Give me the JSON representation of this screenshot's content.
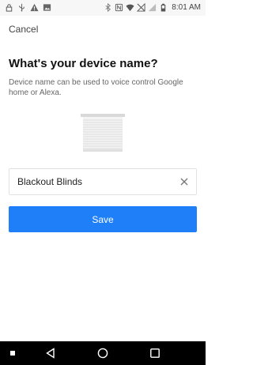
{
  "status_bar": {
    "left_icons": [
      "lock-icon",
      "usb-icon",
      "warning-icon",
      "image-icon"
    ],
    "right_icons": [
      "bluetooth-icon",
      "nfc-icon",
      "wifi-icon",
      "no-signal-icon",
      "signal-icon",
      "battery-icon"
    ],
    "time": "8:01 AM"
  },
  "header": {
    "cancel_label": "Cancel"
  },
  "main": {
    "title": "What's your device name?",
    "subtitle": "Device name can be used to voice control Google home or Alexa.",
    "device_image_icon": "blinds-icon",
    "name_field": {
      "value": "Blackout Blinds",
      "clear_icon": "close-icon"
    },
    "save_label": "Save"
  },
  "colors": {
    "accent": "#1e7ff8",
    "nav_background": "#000000"
  },
  "nav_bar": {
    "items": [
      "square-icon",
      "back-icon",
      "home-icon",
      "recents-icon"
    ]
  }
}
